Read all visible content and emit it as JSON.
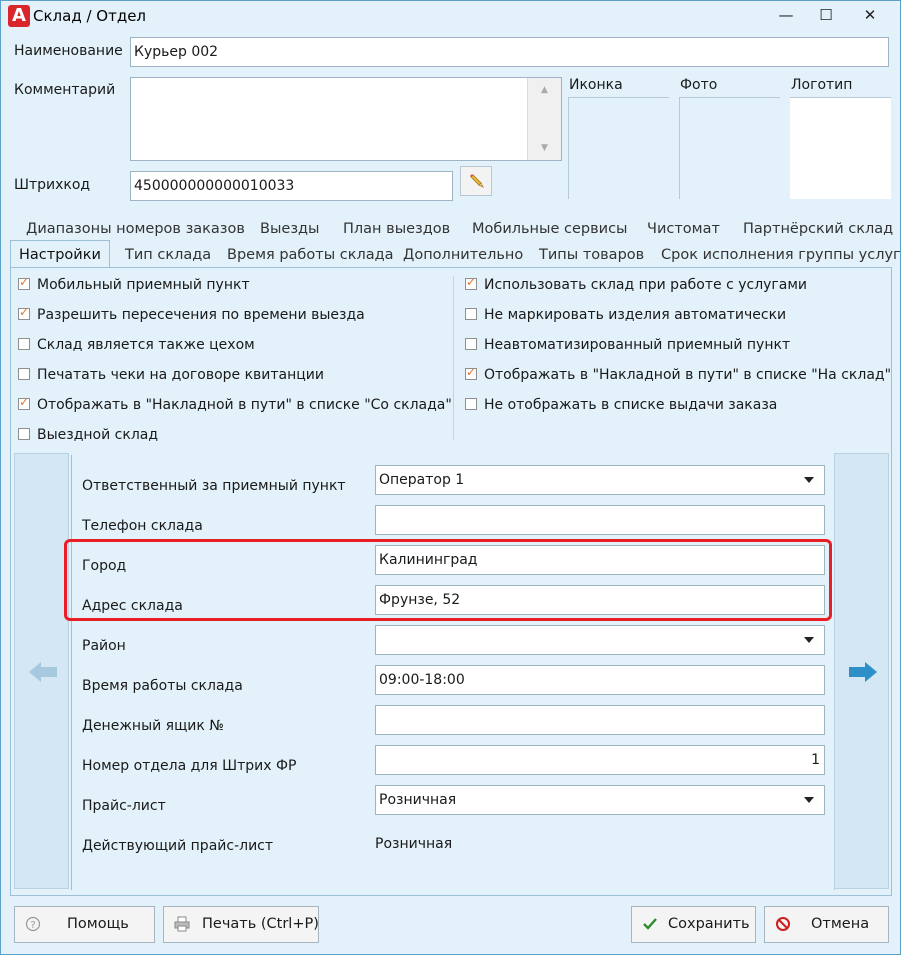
{
  "window": {
    "title": "Склад / Отдел",
    "minimize_icon": "—",
    "maximize_icon": "☐",
    "close_icon": "✕"
  },
  "header": {
    "name_label": "Наименование",
    "name_value": "Курьер 002",
    "comment_label": "Комментарий",
    "comment_value": "",
    "barcode_label": "Штрихкод",
    "barcode_value": "450000000000010033",
    "images": [
      {
        "label": "Иконка"
      },
      {
        "label": "Фото"
      },
      {
        "label": "Логотип"
      }
    ]
  },
  "tabs_row1": [
    "Диапазоны номеров заказов",
    "Выезды",
    "План выездов",
    "Мобильные сервисы",
    "Чистомат",
    "Партнёрский склад"
  ],
  "tabs_row2": [
    "Настройки",
    "Тип склада",
    "Время работы склада",
    "Дополнительно",
    "Типы товаров",
    "Срок исполнения группы услуг"
  ],
  "active_tab": "Настройки",
  "checkboxes_left": [
    {
      "label": "Мобильный приемный пункт",
      "checked": true
    },
    {
      "label": "Разрешить пересечения по времени выезда",
      "checked": true
    },
    {
      "label": "Склад является также цехом",
      "checked": false
    },
    {
      "label": "Печатать чеки на договоре квитанции",
      "checked": false
    },
    {
      "label": "Отображать в \"Накладной в пути\" в списке \"Со склада\"",
      "checked": true
    },
    {
      "label": "Выездной склад",
      "checked": false
    }
  ],
  "checkboxes_right": [
    {
      "label": "Использовать склад при работе с услугами",
      "checked": true
    },
    {
      "label": "Не маркировать изделия автоматически",
      "checked": false
    },
    {
      "label": "Неавтоматизированный приемный пункт",
      "checked": false
    },
    {
      "label": "Отображать в \"Накладной в пути\" в списке \"На склад\"",
      "checked": true
    },
    {
      "label": "Не отображать в списке выдачи заказа",
      "checked": false
    }
  ],
  "form": {
    "responsible_label": "Ответственный за приемный пункт",
    "responsible_value": "Оператор 1",
    "phone_label": "Телефон склада",
    "phone_value": "",
    "city_label": "Город",
    "city_value": "Калининград",
    "address_label": "Адрес склада",
    "address_value": "Фрунзе, 52",
    "district_label": "Район",
    "district_value": "",
    "hours_label": "Время работы склада",
    "hours_value": "09:00-18:00",
    "cashbox_label": "Денежный ящик №",
    "cashbox_value": "",
    "dept_label": "Номер отдела для Штрих ФР",
    "dept_value": "1",
    "pricelist_label": "Прайс-лист",
    "pricelist_value": "Розничная",
    "active_pricelist_label": "Действующий прайс-лист",
    "active_pricelist_value": "Розничная"
  },
  "buttons": {
    "help": "Помощь",
    "print": "Печать (Ctrl+P)",
    "save": "Сохранить",
    "cancel": "Отмена"
  },
  "colors": {
    "accent": "#2f8fc8",
    "highlight": "#e81d25",
    "check": "#e4722b",
    "background": "#e3f2fa"
  }
}
